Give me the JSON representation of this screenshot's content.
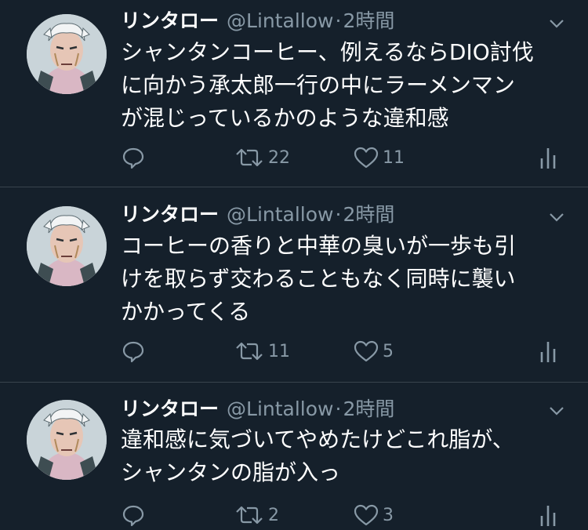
{
  "colors": {
    "background": "#15202b",
    "separator": "#38444d",
    "secondary_text": "#8899a6",
    "primary_text": "#ffffff"
  },
  "tweets": [
    {
      "name": "リンタロー",
      "handle": "@Lintallow",
      "dot": "·",
      "time": "2時間",
      "text": "シャンタンコーヒー、例えるならDIO討伐\nに向かう承太郎一行の中にラーメンマン\nが混じっているかのような違和感",
      "replies": "",
      "retweets": "22",
      "likes": "11"
    },
    {
      "name": "リンタロー",
      "handle": "@Lintallow",
      "dot": "·",
      "time": "2時間",
      "text": "コーヒーの香りと中華の臭いが一歩も引\nけを取らず交わることもなく同時に襲い\nかかってくる",
      "replies": "",
      "retweets": "11",
      "likes": "5"
    },
    {
      "name": "リンタロー",
      "handle": "@Lintallow",
      "dot": "·",
      "time": "2時間",
      "text": "違和感に気づいてやめたけどこれ脂が、\nシャンタンの脂が入っ",
      "replies": "",
      "retweets": "2",
      "likes": "3"
    }
  ],
  "icons": {
    "reply": "reply-icon",
    "retweet": "retweet-icon",
    "like": "heart-icon",
    "analytics": "analytics-icon",
    "caret": "chevron-down-icon",
    "avatar": "avatar"
  }
}
